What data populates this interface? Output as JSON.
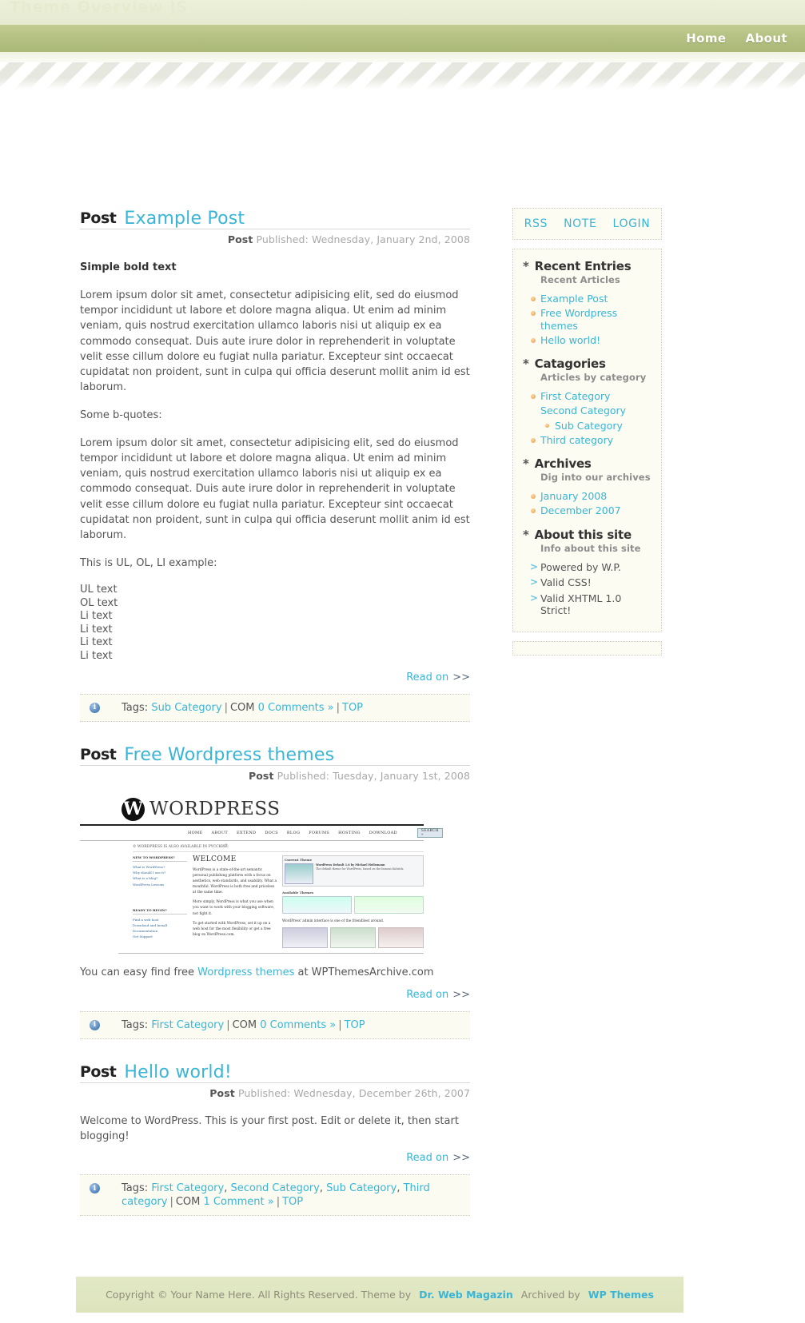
{
  "header": {
    "watermark": "Theme Overview JS",
    "nav": [
      {
        "label": "Home"
      },
      {
        "label": "About"
      }
    ]
  },
  "posts": [
    {
      "kicker": "Post",
      "title": "Example Post",
      "meta_label": "Post",
      "meta_text": "Published: Wednesday, January 2nd, 2008",
      "bold_line": "Simple bold text",
      "paragraph1": "Lorem ipsum dolor sit amet, consectetur adipisicing elit, sed do eiusmod tempor incididunt ut labore et dolore magna aliqua. Ut enim ad minim veniam, quis nostrud exercitation ullamco laboris nisi ut aliquip ex ea commodo consequat. Duis aute irure dolor in reprehenderit in voluptate velit esse cillum dolore eu fugiat nulla pariatur. Excepteur sint occaecat cupidatat non proident, sunt in culpa qui officia deserunt mollit anim id est laborum.",
      "quote_intro": "Some b-quotes:",
      "paragraph2": "Lorem ipsum dolor sit amet, consectetur adipisicing elit, sed do eiusmod tempor incididunt ut labore et dolore magna aliqua. Ut enim ad minim veniam, quis nostrud exercitation ullamco laboris nisi ut aliquip ex ea commodo consequat. Duis aute irure dolor in reprehenderit in voluptate velit esse cillum dolore eu fugiat nulla pariatur. Excepteur sint occaecat cupidatat non proident, sunt in culpa qui officia deserunt mollit anim id est laborum.",
      "list_intro": "This is UL, OL, LI example:",
      "list_items": [
        "UL text",
        "OL text",
        "Li text",
        "Li text",
        "Li text",
        "Li text"
      ],
      "read_on": "Read on",
      "read_on_chevron": ">>",
      "tags": {
        "label": "Tags:",
        "links": [
          "Sub Category"
        ],
        "com_label": "COM",
        "comments": "0 Comments »",
        "top": "TOP"
      }
    },
    {
      "kicker": "Post",
      "title": "Free Wordpress themes",
      "meta_label": "Post",
      "meta_text": "Published: Tuesday, January 1st, 2008",
      "image_alt": "wordpress-org-homepage-screenshot",
      "image_logo": "WORDPRESS",
      "image_nav": [
        "HOME",
        "ABOUT",
        "EXTEND",
        "DOCS",
        "BLOG",
        "FORUMS",
        "HOSTING",
        "DOWNLOAD"
      ],
      "image_search": "SEARCH »",
      "image_notice": "© WORDPRESS IS ALSO AVAILABLE IN PYССКИЙ.",
      "image_welcome": "WELCOME",
      "image_col_head1": "NEW TO WORDPRESS?",
      "image_col_links1": [
        "What is WordPress?",
        "Why should I use it?",
        "What is a blog?",
        "WordPress Lessons"
      ],
      "image_col_head2": "READY TO BEGIN?",
      "image_col_links2": [
        "Find a web host",
        "Download and Install",
        "Documentation",
        "Get Support"
      ],
      "image_body1": "WordPress is a state-of-the-art semantic personal publishing platform with a focus on aesthetics, web standards, and usability. What a mouthful. WordPress is both free and priceless at the same time.",
      "image_body2": "More simply, WordPress is what you use when you want to work with your blogging software, not fight it.",
      "image_body3": "To get started with WordPress, set it up on a web host for the most flexibility or get a free blog on WordPress.com.",
      "image_right_head": "Current Theme",
      "image_right_head2": "Available Themes",
      "image_caption": "WordPress' admin interface is one of the friendliest around.",
      "paragraph_pre": "You can easy find free ",
      "paragraph_link": "Wordpress themes",
      "paragraph_post": " at WPThemesArchive.com",
      "read_on": "Read on",
      "read_on_chevron": ">>",
      "tags": {
        "label": "Tags:",
        "links": [
          "First Category"
        ],
        "com_label": "COM",
        "comments": "0 Comments »",
        "top": "TOP"
      }
    },
    {
      "kicker": "Post",
      "title": "Hello world!",
      "meta_label": "Post",
      "meta_text": "Published: Wednesday, December 26th, 2007",
      "paragraph1": "Welcome to WordPress. This is your first post. Edit or delete it, then start blogging!",
      "read_on": "Read on",
      "read_on_chevron": ">>",
      "tags": {
        "label": "Tags:",
        "links": [
          "First Category",
          "Second Category",
          "Sub Category",
          "Third category"
        ],
        "com_label": "COM",
        "comments": "1 Comment »",
        "top": "TOP"
      }
    }
  ],
  "sidebar": {
    "toplinks": [
      {
        "label": "RSS"
      },
      {
        "label": "NOTE"
      },
      {
        "label": "LOGIN"
      }
    ],
    "groups": [
      {
        "title": "Recent Entries",
        "subtitle": "Recent Articles",
        "items": [
          {
            "label": "Example Post",
            "nested": false
          },
          {
            "label": "Free Wordpress themes",
            "nested": false
          },
          {
            "label": "Hello world!",
            "nested": false
          }
        ]
      },
      {
        "title": "Catagories",
        "subtitle": "Articles by category",
        "items": [
          {
            "label": "First Category",
            "nested": false
          },
          {
            "label": "Second Category",
            "nested": false,
            "nobullet": true
          },
          {
            "label": "Sub Category",
            "nested": true
          },
          {
            "label": "Third category",
            "nested": false
          }
        ]
      },
      {
        "title": "Archives",
        "subtitle": "Dig into our archives",
        "items": [
          {
            "label": "January 2008",
            "nested": false
          },
          {
            "label": "December 2007",
            "nested": false
          }
        ]
      }
    ],
    "about": {
      "title": "About this site",
      "subtitle": "Info about this site",
      "items": [
        {
          "label": "Powered by W.P."
        },
        {
          "label": "Valid CSS!"
        },
        {
          "label": "Valid XHTML 1.0 Strict!"
        }
      ]
    }
  },
  "footer": {
    "copyright": "Copyright © Your Name Here. All Rights Reserved. Theme by",
    "theme_author": "Dr. Web Magazin",
    "archived_by": "Archived by",
    "archive_site": "WP Themes"
  },
  "colors": {
    "accent_cyan": "#3ab5d6",
    "header_green": "#b5c182",
    "sidebar_cream": "#fcfcf2",
    "bullet_orange": "#e8a858",
    "footer_green": "#e2e8c6"
  }
}
